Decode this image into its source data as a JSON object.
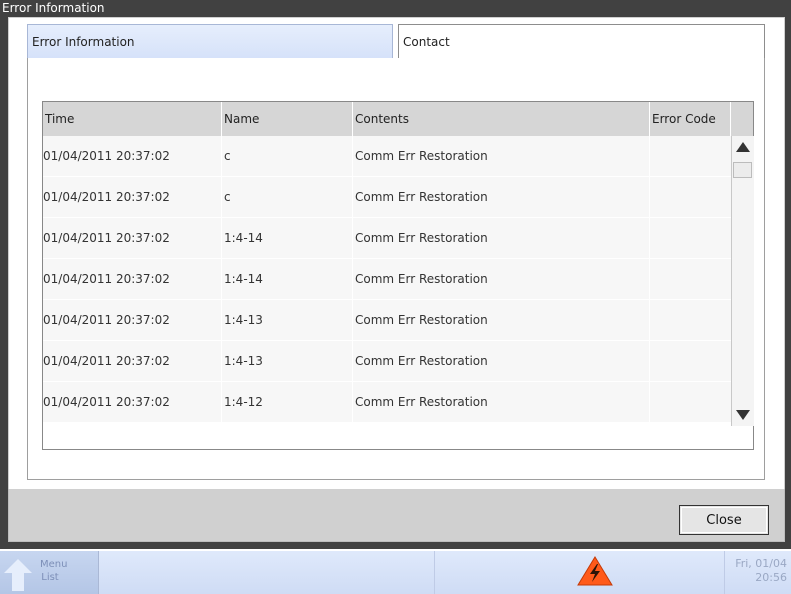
{
  "window": {
    "title": "Error Information"
  },
  "tabs": [
    {
      "label": "Error Information",
      "active": true
    },
    {
      "label": "Contact",
      "active": false
    }
  ],
  "table": {
    "columns": [
      "Time",
      "Name",
      "Contents",
      "Error Code"
    ],
    "rows": [
      {
        "time": "01/04/2011 20:37:02",
        "name": "c",
        "contents": "Comm Err Restoration",
        "error_code": ""
      },
      {
        "time": "01/04/2011 20:37:02",
        "name": "c",
        "contents": "Comm Err Restoration",
        "error_code": ""
      },
      {
        "time": "01/04/2011 20:37:02",
        "name": "1:4-14",
        "contents": "Comm Err Restoration",
        "error_code": ""
      },
      {
        "time": "01/04/2011 20:37:02",
        "name": "1:4-14",
        "contents": "Comm Err Restoration",
        "error_code": ""
      },
      {
        "time": "01/04/2011 20:37:02",
        "name": "1:4-13",
        "contents": "Comm Err Restoration",
        "error_code": ""
      },
      {
        "time": "01/04/2011 20:37:02",
        "name": "1:4-13",
        "contents": "Comm Err Restoration",
        "error_code": ""
      },
      {
        "time": "01/04/2011 20:37:02",
        "name": "1:4-12",
        "contents": "Comm Err Restoration",
        "error_code": ""
      }
    ]
  },
  "buttons": {
    "close": "Close"
  },
  "taskbar": {
    "menu_label_line1": "Menu",
    "menu_label_line2": "List",
    "date": "Fri, 01/04",
    "time": "20:56",
    "alert_icon": "warning-triangle-icon"
  },
  "colors": {
    "alert": "#ff5a1a",
    "window_bg": "#414141",
    "tab_active": "#d6e2fa"
  }
}
